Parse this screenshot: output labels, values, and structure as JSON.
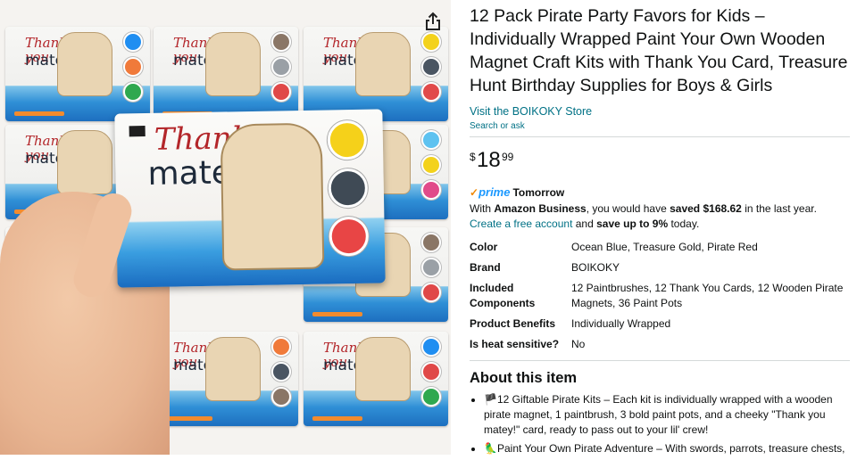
{
  "product": {
    "title": "12 Pack Pirate Party Favors for Kids – Individually Wrapped Paint Your Own Wooden Magnet Craft Kits with Thank You Card, Treasure Hunt Birthday Supplies for Boys & Girls",
    "store_link": "Visit the BOIKOKY Store",
    "search_ask": "Search or ask"
  },
  "price": {
    "symbol": "$",
    "whole": "18",
    "fraction": "99"
  },
  "delivery": {
    "prime_label": "prime",
    "prime_text": "Tomorrow"
  },
  "business": {
    "text_1": "With ",
    "bold_1": "Amazon Business",
    "text_2": ", you would have ",
    "bold_2": "saved $168.62",
    "text_3": " in the last year. ",
    "link": "Create a free account",
    "text_4": " and ",
    "bold_3": "save up to 9%",
    "text_5": " today."
  },
  "specs": [
    {
      "key": "Color",
      "value": "Ocean Blue, Treasure Gold, Pirate Red"
    },
    {
      "key": "Brand",
      "value": "BOIKOKY"
    },
    {
      "key": "Included Components",
      "value": "12 Paintbrushes, 12 Thank You Cards, 12 Wooden Pirate Magnets, 36 Paint Pots"
    },
    {
      "key": "Product Benefits",
      "value": "Individually Wrapped"
    },
    {
      "key": "Is heat sensitive?",
      "value": "No"
    }
  ],
  "about": {
    "title": "About this item",
    "bullets": [
      {
        "icon": "flag-icon",
        "glyph": "🏴",
        "text": "12 Giftable Pirate Kits – Each kit is individually wrapped with a wooden pirate magnet, 1 paintbrush, 3 bold paint pots, and a cheeky \"Thank you matey!\" card, ready to pass out to your lil' crew!"
      },
      {
        "icon": "parrot-icon",
        "glyph": "🦜",
        "text": "Paint Your Own Pirate Adventure – With swords, parrots, treasure chests,"
      }
    ]
  },
  "image": {
    "card_caption_1": "Thank you",
    "card_caption_2": "matey!",
    "hero_caption_1": "Thank",
    "hero_caption_2": "matey"
  },
  "colors": {
    "link": "#007185",
    "prime_blue": "#1a98ff",
    "prime_check": "#f08804",
    "card_red": "#b3262a"
  }
}
